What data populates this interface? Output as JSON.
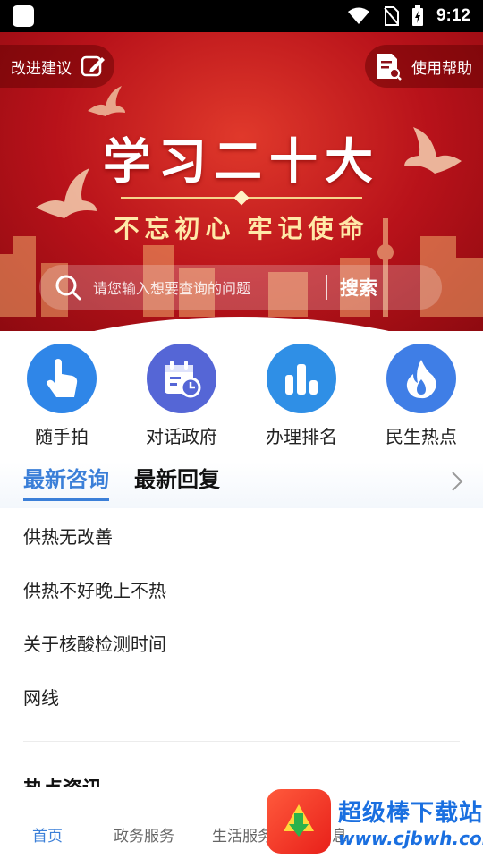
{
  "status_bar": {
    "time": "9:12"
  },
  "banner": {
    "title": "学习二十大",
    "subtitle": "不忘初心 牢记使命",
    "suggest_label": "改进建议",
    "help_label": "使用帮助"
  },
  "search": {
    "placeholder": "请您输入想要查询的问题",
    "button_label": "搜索"
  },
  "quick_actions": [
    {
      "label": "随手拍",
      "icon": "tap-hand-icon",
      "color": "#2f86e8"
    },
    {
      "label": "对话政府",
      "icon": "calendar-clock-icon",
      "color": "#5566d6"
    },
    {
      "label": "办理排名",
      "icon": "bar-chart-icon",
      "color": "#2f8fe6"
    },
    {
      "label": "民生热点",
      "icon": "flame-icon",
      "color": "#3f7ee6"
    }
  ],
  "tabs": [
    {
      "label": "最新咨询",
      "active": true
    },
    {
      "label": "最新回复",
      "active": false
    }
  ],
  "list_items": [
    "供热无改善",
    "供热不好晚上不热",
    "关于核酸检测时间",
    "网线"
  ],
  "next_section_title": "热点资讯",
  "bottom_nav": [
    {
      "label": "首页",
      "active": true
    },
    {
      "label": "政务服务",
      "active": false
    },
    {
      "label": "生活服务",
      "active": false
    },
    {
      "label": "消息",
      "active": false
    }
  ],
  "watermark": {
    "title": "超级棒下载站",
    "url": "www.cjbwh.com"
  },
  "colors": {
    "accent": "#3b7fd8",
    "banner_red": "#b8121a"
  }
}
